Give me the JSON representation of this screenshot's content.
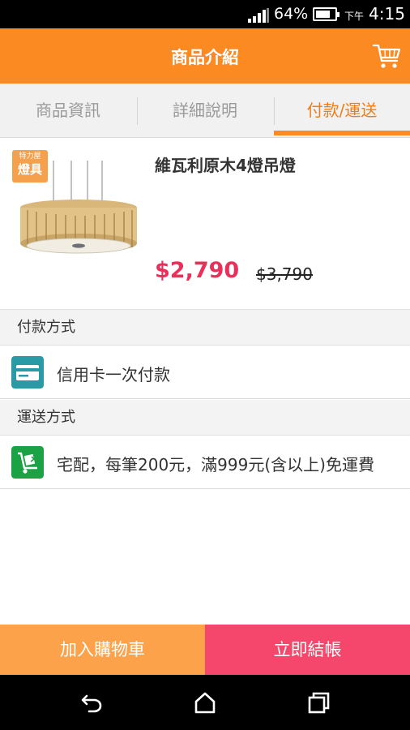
{
  "status_bar": {
    "battery_percent": "64%",
    "battery_level": 0.64,
    "ampm": "下午",
    "time": "4:15"
  },
  "app_bar": {
    "title": "商品介紹",
    "cart_icon": "shopping-cart-icon"
  },
  "tabs": [
    {
      "label": "商品資訊",
      "active": false
    },
    {
      "label": "詳細說明",
      "active": false
    },
    {
      "label": "付款/運送",
      "active": true
    }
  ],
  "product": {
    "badge_line1": "特力屋",
    "badge_line2": "燈具",
    "name": "維瓦利原木4燈吊燈",
    "price": "$2,790",
    "original_price": "$3,790"
  },
  "payment": {
    "heading": "付款方式",
    "method": "信用卡一次付款",
    "icon": "credit-card-icon",
    "icon_color": "#2a9aa6"
  },
  "shipping": {
    "heading": "運送方式",
    "method": "宅配，每筆200元，滿999元(含以上)免運費",
    "icon": "delivery-truck-icon",
    "icon_color": "#1aa245"
  },
  "actions": {
    "add_to_cart": "加入購物車",
    "checkout": "立即結帳"
  },
  "colors": {
    "accent": "#fb8a23",
    "price": "#e8305b",
    "add_to_cart_bg": "#fca24a",
    "checkout_bg": "#f5466b"
  }
}
